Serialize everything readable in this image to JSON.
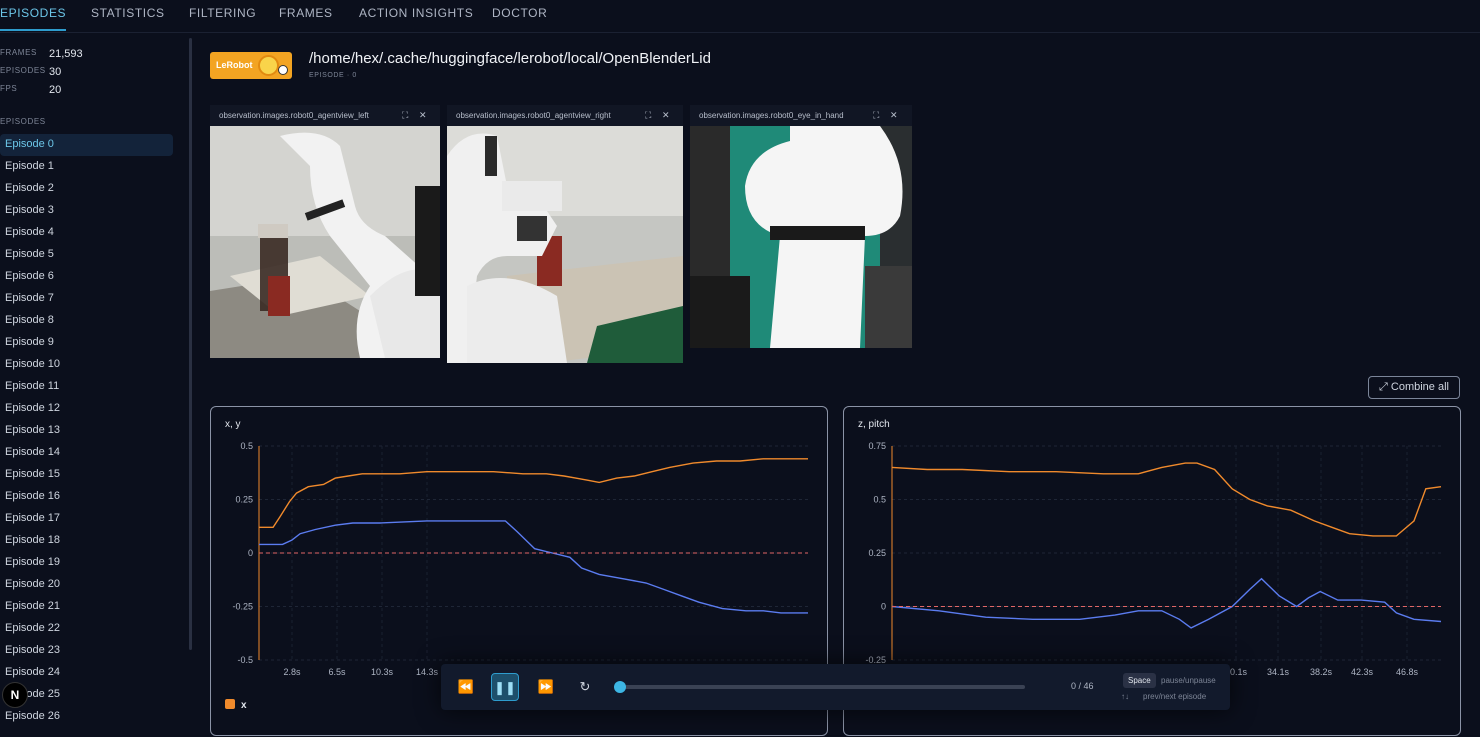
{
  "nav": {
    "tabs": [
      "EPISODES",
      "STATISTICS",
      "FILTERING",
      "FRAMES",
      "ACTION INSIGHTS",
      "DOCTOR"
    ],
    "active": 0
  },
  "stats": {
    "frames_label": "FRAMES",
    "frames": "21,593",
    "episodes_label": "EPISODES",
    "episodes": "30",
    "fps_label": "FPS",
    "fps": "20"
  },
  "sidebar": {
    "section_label": "EPISODES",
    "episodes": [
      "Episode 0",
      "Episode 1",
      "Episode 2",
      "Episode 3",
      "Episode 4",
      "Episode 5",
      "Episode 6",
      "Episode 7",
      "Episode 8",
      "Episode 9",
      "Episode 10",
      "Episode 11",
      "Episode 12",
      "Episode 13",
      "Episode 14",
      "Episode 15",
      "Episode 16",
      "Episode 17",
      "Episode 18",
      "Episode 19",
      "Episode 20",
      "Episode 21",
      "Episode 22",
      "Episode 23",
      "Episode 24",
      "Episode 25",
      "Episode 26"
    ],
    "active": 0
  },
  "header": {
    "logo_text": "LeRobot",
    "dataset_path": "/home/hex/.cache/huggingface/lerobot/local/OpenBlenderLid",
    "episode_label": "EPISODE · 0"
  },
  "videos": [
    {
      "title": "observation.images.robot0_agentview_left"
    },
    {
      "title": "observation.images.robot0_agentview_right"
    },
    {
      "title": "observation.images.robot0_eye_in_hand"
    }
  ],
  "combine_label": "Combine all",
  "colors": {
    "orange": "#f08a2c",
    "blue": "#5b7cf0",
    "red_dash": "#e06666",
    "accent": "#2e9ccd"
  },
  "chart_data": [
    {
      "type": "line",
      "title": "x, y",
      "xlabel": "",
      "ylabel": "",
      "x_ticks": [
        "2.8s",
        "6.5s",
        "10.3s",
        "14.3s"
      ],
      "y_ticks": [
        "0.5",
        "0.25",
        "0",
        "-0.25",
        "-0.5"
      ],
      "ylim": [
        -0.5,
        0.5
      ],
      "xlim": [
        0,
        46.8
      ],
      "series": [
        {
          "color": "orange",
          "x": [
            0,
            1.2,
            1.8,
            2.6,
            3.2,
            4.2,
            5.5,
            6.5,
            7.6,
            8.8,
            10.3,
            12,
            14.3,
            17,
            20,
            22.5,
            24.5,
            26,
            27,
            28,
            29,
            30.5,
            32,
            33.5,
            35,
            37,
            39,
            41,
            43,
            44.5,
            46.8
          ],
          "y": [
            0.12,
            0.12,
            0.17,
            0.24,
            0.28,
            0.31,
            0.32,
            0.35,
            0.36,
            0.37,
            0.37,
            0.37,
            0.38,
            0.38,
            0.38,
            0.37,
            0.37,
            0.36,
            0.35,
            0.34,
            0.33,
            0.35,
            0.36,
            0.38,
            0.4,
            0.42,
            0.43,
            0.43,
            0.44,
            0.44,
            0.44
          ]
        },
        {
          "color": "blue",
          "x": [
            0,
            2,
            2.8,
            3.5,
            4.8,
            6.5,
            8,
            10.3,
            14.3,
            18,
            21,
            22,
            23.5,
            25,
            26.5,
            27.5,
            29,
            31,
            33,
            34.5,
            36,
            37.5,
            39.5,
            41.5,
            43,
            44.5,
            46.8
          ],
          "y": [
            0.04,
            0.04,
            0.06,
            0.09,
            0.11,
            0.13,
            0.14,
            0.14,
            0.15,
            0.15,
            0.15,
            0.1,
            0.02,
            0.0,
            -0.02,
            -0.07,
            -0.1,
            -0.12,
            -0.14,
            -0.17,
            -0.2,
            -0.23,
            -0.26,
            -0.27,
            -0.27,
            -0.28,
            -0.28
          ]
        },
        {
          "color": "red_dash",
          "x": [
            0,
            46.8
          ],
          "y": [
            0,
            0
          ]
        }
      ],
      "legend": [
        {
          "label": "x",
          "checked": true
        }
      ]
    },
    {
      "type": "line",
      "title": "z, pitch",
      "xlabel": "",
      "ylabel": "",
      "x_ticks": [
        "30.1s",
        "34.1s",
        "38.2s",
        "42.3s",
        "46.8s"
      ],
      "y_ticks": [
        "0.75",
        "0.5",
        "0.25",
        "0",
        "-0.25"
      ],
      "ylim": [
        -0.25,
        0.75
      ],
      "xlim": [
        0,
        46.8
      ],
      "series": [
        {
          "color": "orange",
          "x": [
            0,
            3,
            6,
            10,
            14,
            18,
            21,
            23,
            25,
            26,
            27.5,
            29,
            30.5,
            32,
            34,
            36,
            37.5,
            39,
            41,
            43,
            44.5,
            45.5,
            46.8
          ],
          "y": [
            0.65,
            0.64,
            0.64,
            0.63,
            0.63,
            0.62,
            0.62,
            0.65,
            0.67,
            0.67,
            0.64,
            0.55,
            0.5,
            0.47,
            0.45,
            0.4,
            0.37,
            0.34,
            0.33,
            0.33,
            0.4,
            0.55,
            0.56
          ]
        },
        {
          "color": "blue",
          "x": [
            0,
            4,
            8,
            12,
            16,
            19,
            21,
            23,
            24.5,
            25.5,
            27,
            29,
            30.5,
            31.5,
            33,
            34.5,
            35.5,
            36.5,
            38,
            40,
            42,
            43,
            44.5,
            46.8
          ],
          "y": [
            0.0,
            -0.02,
            -0.05,
            -0.06,
            -0.06,
            -0.04,
            -0.02,
            -0.02,
            -0.06,
            -0.1,
            -0.06,
            0.0,
            0.08,
            0.13,
            0.05,
            0.0,
            0.04,
            0.07,
            0.03,
            0.03,
            0.02,
            -0.03,
            -0.06,
            -0.07
          ]
        },
        {
          "color": "red_dash",
          "x": [
            0,
            46.8
          ],
          "y": [
            0,
            0
          ]
        }
      ]
    }
  ],
  "player": {
    "count": "0 / 46",
    "key_space": "Space",
    "hint_space": "pause/unpause",
    "hint_arrows": "prev/next episode",
    "progress": 0
  }
}
